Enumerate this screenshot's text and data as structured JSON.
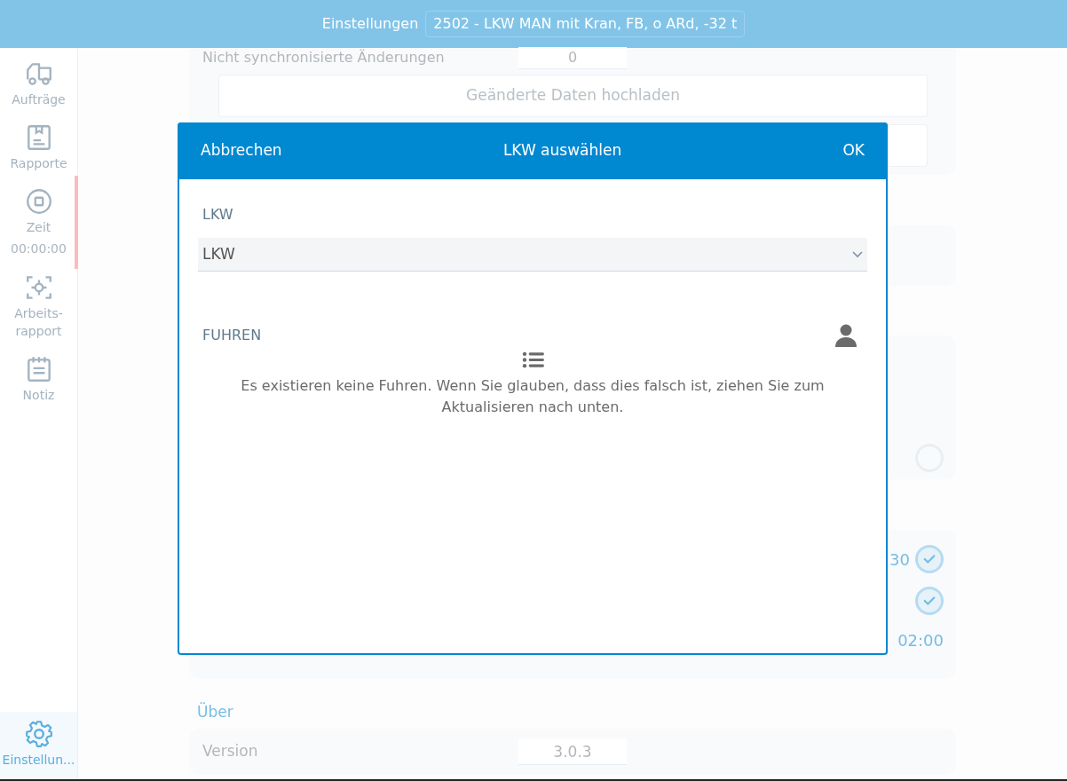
{
  "header": {
    "title": "Einstellungen",
    "vehicle": "2502 - LKW MAN mit Kran, FB, o ARd, -32 t"
  },
  "sidebar": {
    "items": [
      {
        "kind": "truck",
        "label": "Aufträge",
        "selected": false,
        "highlighted": false
      },
      {
        "kind": "report",
        "label": "Rapporte",
        "selected": false,
        "highlighted": false
      },
      {
        "kind": "stop",
        "label": "Zeit",
        "time": "00:00:00",
        "selected": false,
        "highlighted": true
      },
      {
        "kind": "focus",
        "label": "Arbeits-\nrapport",
        "selected": false,
        "highlighted": false
      },
      {
        "kind": "note",
        "label": "Notiz",
        "selected": false,
        "highlighted": false
      },
      {
        "kind": "gear",
        "label": "Einstellun...",
        "selected": true,
        "highlighted": false
      }
    ]
  },
  "settings": {
    "sync_row": {
      "label": "Nicht synchronisierte Änderungen",
      "value": "0"
    },
    "upload_button": "Geänderte Daten hochladen",
    "panel_3": {
      "check": {
        "checked": false
      }
    },
    "panel_4": {
      "value_1": "30",
      "checks": [
        {
          "checked": true
        },
        {
          "checked": true
        }
      ],
      "value_2": "02:00"
    },
    "about": {
      "heading": "Über",
      "version_label": "Version",
      "version_value": "3.0.3"
    }
  },
  "dialog": {
    "cancel": "Abbrechen",
    "title": "LKW auswählen",
    "ok": "OK",
    "truck_field": {
      "label": "LKW",
      "value": "LKW"
    },
    "trips": {
      "heading": "FUHREN",
      "empty_message": "Es existieren keine Fuhren. Wenn Sie glauben, dass dies falsch ist, ziehen Sie zum Aktualisieren nach unten."
    }
  }
}
